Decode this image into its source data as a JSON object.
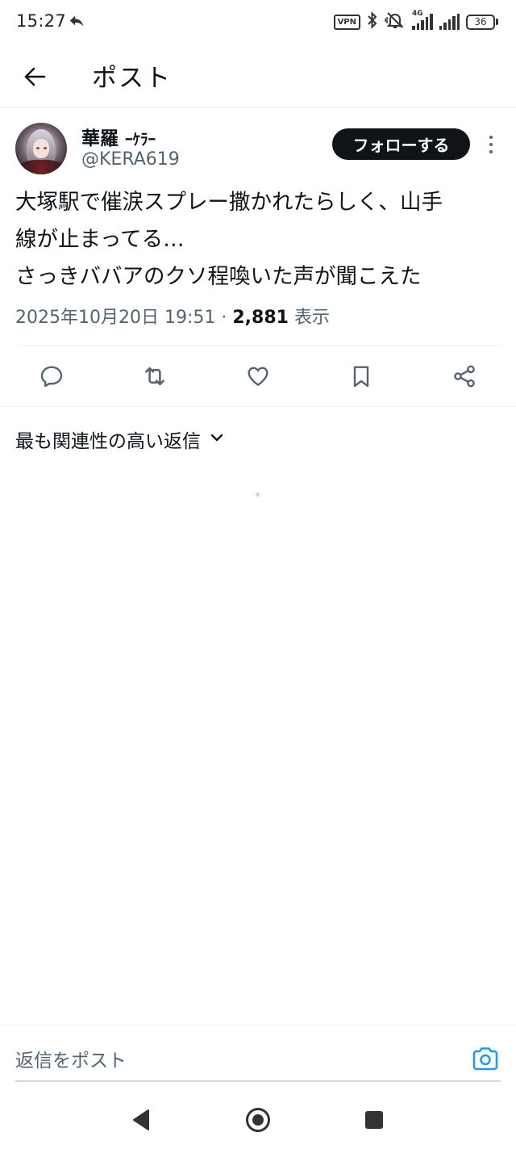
{
  "status_bar": {
    "time": "15:27",
    "vpn_label": "VPN",
    "network_label": "4G",
    "battery_level": "36"
  },
  "header": {
    "title": "ポスト",
    "back_icon": "arrow-left-icon"
  },
  "post": {
    "author": {
      "display_name": "華羅",
      "name_tag": "ｰｹﾗｰ",
      "handle": "@KERA619"
    },
    "follow_label": "フォローする",
    "text_lines": [
      "大塚駅で催涙スプレー撒かれたらしく、山手",
      "線が止まってる…",
      "さっきババアのクソ程喚いた声が聞こえた"
    ],
    "timestamp": "2025年10月20日 19:51",
    "separator": "·",
    "views_count": "2,881",
    "views_label": "表示",
    "actions": [
      "reply-icon",
      "retweet-icon",
      "like-icon",
      "bookmark-icon",
      "share-icon"
    ]
  },
  "replies": {
    "sort_label": "最も関連性の高い返信"
  },
  "composer": {
    "placeholder": "返信をポスト"
  },
  "colors": {
    "text_primary": "#0f1419",
    "text_secondary": "#536471",
    "accent": "#1d9bf0",
    "divider": "#eff3f4"
  }
}
